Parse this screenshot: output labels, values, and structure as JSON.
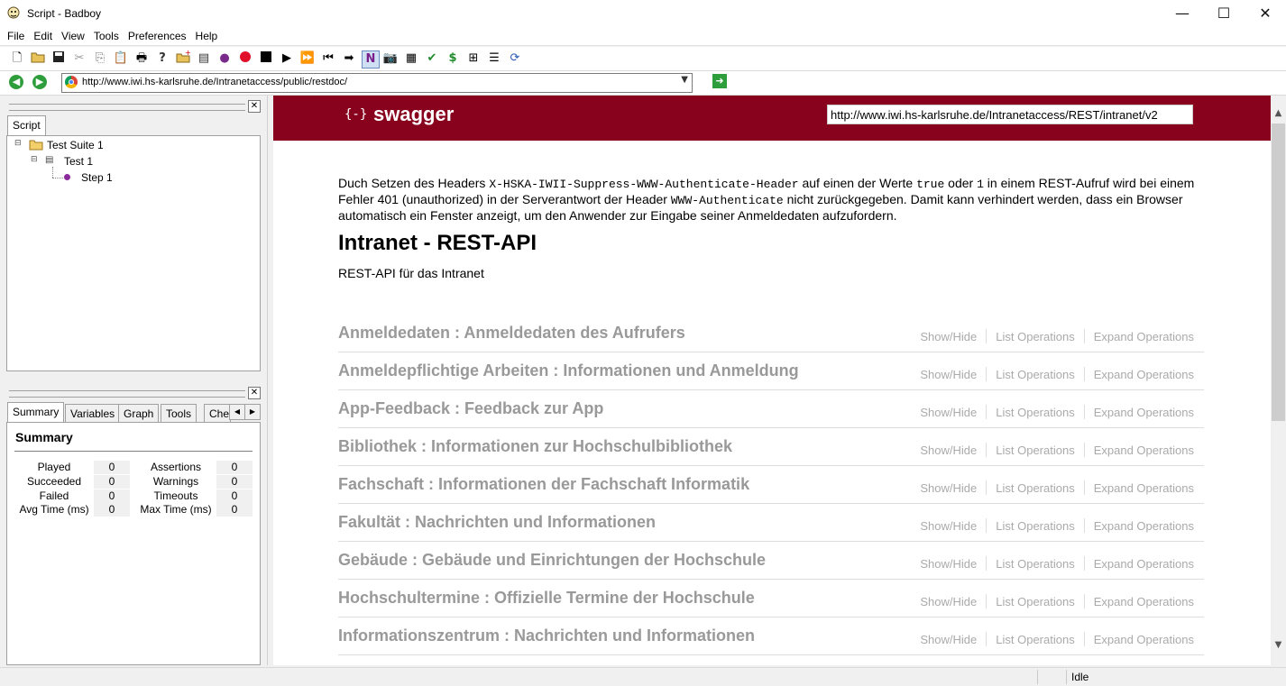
{
  "window": {
    "title": "Script - Badboy",
    "minimize_glyph": "—",
    "maximize_glyph": "☐",
    "close_glyph": "✕"
  },
  "menu": [
    "File",
    "Edit",
    "View",
    "Tools",
    "Preferences",
    "Help"
  ],
  "toolbar_icons": [
    "new-icon",
    "open-icon",
    "save-icon",
    "cut-icon",
    "copy-icon",
    "paste-icon",
    "print-icon",
    "help-icon",
    "new-folder-icon",
    "add-step-icon",
    "add-item-icon",
    "record-icon",
    "stop-icon",
    "play-icon",
    "play-all-icon",
    "rewind-icon",
    "step-forward-icon",
    "navigation-icon",
    "screenshot-icon",
    "page-icon",
    "check-icon",
    "variable-icon",
    "table-icon",
    "tree-icon",
    "refresh-icon"
  ],
  "address": {
    "url": "http://www.iwi.hs-karlsruhe.de/Intranetaccess/public/restdoc/"
  },
  "script_panel": {
    "tab": "Script",
    "tree": {
      "suite": "Test Suite 1",
      "test": "Test 1",
      "step": "Step 1"
    }
  },
  "summary_panel": {
    "tabs": [
      "Summary",
      "Variables",
      "Graph",
      "Tools",
      "Che"
    ],
    "heading": "Summary",
    "left_stats": [
      {
        "label": "Played",
        "value": "0"
      },
      {
        "label": "Succeeded",
        "value": "0"
      },
      {
        "label": "Failed",
        "value": "0"
      },
      {
        "label": "Avg Time (ms)",
        "value": "0"
      }
    ],
    "right_stats": [
      {
        "label": "Assertions",
        "value": "0"
      },
      {
        "label": "Warnings",
        "value": "0"
      },
      {
        "label": "Timeouts",
        "value": "0"
      },
      {
        "label": "Max Time (ms)",
        "value": "0"
      }
    ]
  },
  "swagger": {
    "logo": "{-}",
    "brand": "swagger",
    "api_url": "http://www.iwi.hs-karlsruhe.de/Intranetaccess/REST/intranet/v2",
    "accent": "#89021d",
    "desc": {
      "t1": "Duch Setzen des Headers ",
      "c1": "X-HSKA-IWII-Suppress-WWW-Authenticate-Header",
      "t2": " auf einen der Werte ",
      "c2": "true",
      "t3": " oder ",
      "c3": "1",
      "t4": " in einem REST-Aufruf wird bei einem Fehler 401 (unauthorized) in der Serverantwort der Header ",
      "c4": "WWW-Authenticate",
      "t5": " nicht zurückgegeben. Damit kann verhindert werden, dass ein Browser automatisch ein Fenster anzeigt, um den Anwender zur Eingabe seiner Anmeldedaten aufzufordern."
    },
    "title": "Intranet - REST-API",
    "subtitle": "REST-API für das Intranet",
    "ops": {
      "show_hide": "Show/Hide",
      "list": "List Operations",
      "expand": "Expand Operations"
    },
    "resources": [
      "Anmeldedaten : Anmeldedaten des Aufrufers",
      "Anmeldepflichtige Arbeiten : Informationen und Anmeldung",
      "App-Feedback : Feedback zur App",
      "Bibliothek : Informationen zur Hochschulbibliothek",
      "Fachschaft : Informationen der Fachschaft Informatik",
      "Fakultät : Nachrichten und Informationen",
      "Gebäude : Gebäude und Einrichtungen der Hochschule",
      "Hochschultermine : Offizielle Termine der Hochschule",
      "Informationszentrum : Nachrichten und Informationen"
    ]
  },
  "status": {
    "text": "Idle"
  }
}
